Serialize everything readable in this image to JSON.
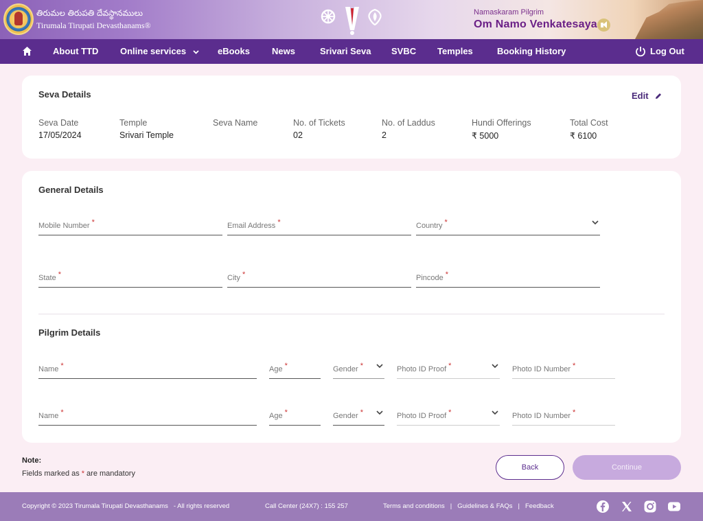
{
  "header": {
    "logo_telugu": "తిరుమల తిరుపతి దేవస్థానములు",
    "logo_english": "Tirumala Tirupati Devasthanams®",
    "greeting_small": "Namaskaram Pilgrim",
    "greeting_big": "Om Namo Venkatesaya"
  },
  "nav": {
    "items": [
      {
        "label": "About TTD"
      },
      {
        "label": "Online services"
      },
      {
        "label": "eBooks"
      },
      {
        "label": "News"
      },
      {
        "label": "Srivari Seva"
      },
      {
        "label": "SVBC"
      },
      {
        "label": "Temples"
      },
      {
        "label": "Booking History"
      }
    ],
    "logout_label": "Log Out"
  },
  "seva": {
    "title": "Seva Details",
    "edit_label": "Edit",
    "columns": [
      {
        "label": "Seva Date",
        "value": "17/05/2024"
      },
      {
        "label": "Temple",
        "value": "Srivari Temple"
      },
      {
        "label": "Seva Name",
        "value": ""
      },
      {
        "label": "No. of Tickets",
        "value": "02"
      },
      {
        "label": "No. of Laddus",
        "value": "2"
      },
      {
        "label": "Hundi Offerings",
        "value": "₹ 5000"
      },
      {
        "label": "Total Cost",
        "value": "₹ 6100"
      }
    ]
  },
  "general": {
    "title": "General Details",
    "mobile_label": "Mobile Number",
    "email_label": "Email Address",
    "country_label": "Country",
    "state_label": "State",
    "city_label": "City",
    "pincode_label": "Pincode"
  },
  "pilgrim": {
    "title": "Pilgrim Details",
    "rows": [
      {
        "name_label": "Name",
        "age_label": "Age",
        "gender_label": "Gender",
        "id_proof_label": "Photo ID Proof",
        "id_number_label": "Photo ID Number"
      },
      {
        "name_label": "Name",
        "age_label": "Age",
        "gender_label": "Gender",
        "id_proof_label": "Photo ID Proof",
        "id_number_label": "Photo ID Number"
      }
    ]
  },
  "required_mark": "*",
  "note": {
    "title": "Note:",
    "text_before": "Fields marked as",
    "text_after": "are mandatory"
  },
  "buttons": {
    "back": "Back",
    "continue": "Continue"
  },
  "footer": {
    "copyright": "Copyright © 2023 Tirumala Tirupati Devasthanams   - All rights reserved",
    "call_center": "Call Center (24X7) : 155 257",
    "links": [
      "Terms and conditions",
      "Guidelines & FAQs",
      "Feedback"
    ],
    "link_separator": "|",
    "social_icons": [
      "facebook-icon",
      "x-icon",
      "instagram-icon",
      "youtube-icon"
    ]
  },
  "colors": {
    "nav_bg": "#5b2d8e",
    "footer_bg": "#9b7cb8",
    "page_bg": "#fbeef4",
    "continue_disabled": "#c7aade",
    "required": "#cc3333"
  }
}
